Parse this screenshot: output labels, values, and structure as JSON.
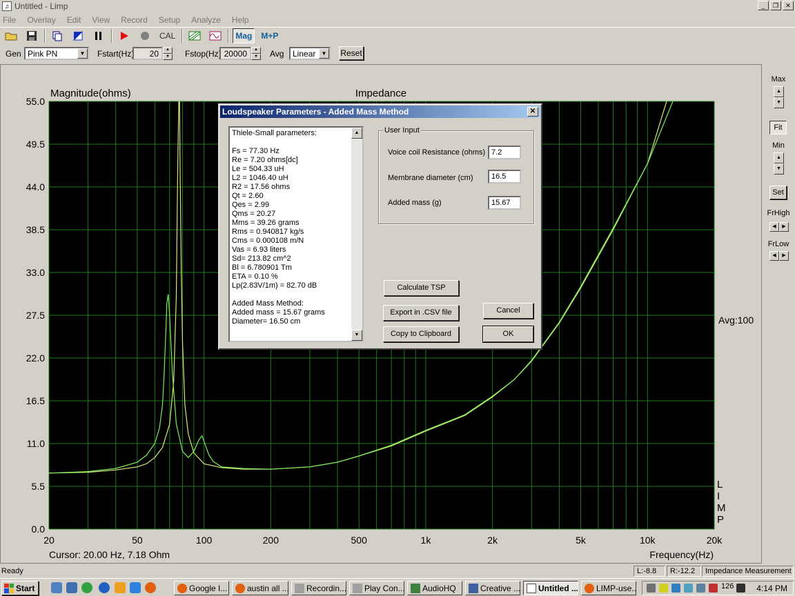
{
  "window": {
    "title": "Untitled - Limp",
    "min_glyph": "_",
    "max_glyph": "❐",
    "close_glyph": "✕"
  },
  "menu": [
    "File",
    "Overlay",
    "Edit",
    "View",
    "Record",
    "Setup",
    "Analyze",
    "Help"
  ],
  "toolbar": {
    "cal_label": "CAL",
    "mag_label": "Mag",
    "mp_label": "M+P"
  },
  "genbar": {
    "gen_label": "Gen",
    "gen_value": "Pink PN",
    "fstart_label": "Fstart(Hz)",
    "fstart_value": "20",
    "fstop_label": "Fstop(Hz)",
    "fstop_value": "20000",
    "avg_label": "Avg",
    "avg_value": "Linear",
    "reset_label": "Reset"
  },
  "chart_data": {
    "type": "line",
    "title": "Impedance",
    "ylabel": "Magnitude(ohms)",
    "xlabel": "Frequency(Hz)",
    "x_scale": "log",
    "xlim": [
      20,
      20000
    ],
    "ylim": [
      0,
      55
    ],
    "y_ticks": [
      "0.0",
      "5.5",
      "11.0",
      "16.5",
      "22.0",
      "27.5",
      "33.0",
      "38.5",
      "44.0",
      "49.5",
      "55.0"
    ],
    "x_ticks": [
      {
        "value": 20,
        "label": "20"
      },
      {
        "value": 50,
        "label": "50"
      },
      {
        "value": 100,
        "label": "100"
      },
      {
        "value": 200,
        "label": "200"
      },
      {
        "value": 500,
        "label": "500"
      },
      {
        "value": 1000,
        "label": "1k"
      },
      {
        "value": 2000,
        "label": "2k"
      },
      {
        "value": 5000,
        "label": "5k"
      },
      {
        "value": 10000,
        "label": "10k"
      },
      {
        "value": 20000,
        "label": "20k"
      }
    ],
    "grid": true,
    "background": "#000000",
    "grid_color": "#1f7a1f",
    "cursor_text": "Cursor: 20.00 Hz, 7.18 Ohm",
    "avg_text": "Avg:100",
    "side_text": [
      "L",
      "I",
      "M",
      "P"
    ],
    "series": [
      {
        "color": "#d8e878",
        "x": [
          20,
          30,
          40,
          50,
          55,
          60,
          65,
          70,
          73,
          75,
          76,
          77,
          77.3,
          77.6,
          78,
          79,
          80,
          82,
          85,
          90,
          100,
          120,
          150,
          200,
          300,
          400,
          500,
          700,
          1000,
          1500,
          2000,
          2500,
          3000,
          4000,
          5000,
          7000,
          10000,
          12500
        ],
        "y": [
          7.2,
          7.3,
          7.6,
          8.0,
          8.4,
          9.2,
          10.5,
          13.5,
          19.0,
          30.0,
          45.0,
          55.0,
          56.0,
          55.0,
          47.0,
          33.0,
          24.0,
          16.0,
          12.2,
          9.8,
          8.4,
          7.9,
          7.7,
          7.7,
          8.0,
          8.6,
          9.4,
          10.7,
          12.6,
          14.6,
          17.0,
          19.2,
          21.6,
          26.5,
          31.0,
          38.5,
          47.0,
          56.0
        ]
      },
      {
        "color": "#7aee5a",
        "x": [
          20,
          30,
          40,
          50,
          55,
          60,
          63,
          65,
          66,
          67,
          68,
          69,
          70,
          72,
          75,
          80,
          85,
          90,
          95,
          98,
          100,
          105,
          110,
          120,
          150,
          200,
          300,
          400,
          500,
          700,
          1000,
          1500,
          2000,
          2500,
          3000,
          4000,
          5000,
          7000,
          10000,
          13000
        ],
        "y": [
          7.2,
          7.4,
          7.8,
          8.6,
          9.5,
          11.0,
          13.0,
          16.0,
          19.5,
          24.0,
          29.0,
          30.2,
          27.5,
          20.0,
          13.5,
          10.0,
          9.2,
          10.0,
          11.5,
          12.0,
          11.3,
          9.6,
          8.7,
          8.0,
          7.8,
          7.7,
          8.0,
          8.6,
          9.4,
          10.8,
          12.7,
          14.7,
          17.1,
          19.2,
          21.7,
          26.6,
          31.2,
          38.7,
          47.0,
          55.0
        ]
      }
    ]
  },
  "rightpanel": {
    "max_label": "Max",
    "fit_label": "Fit",
    "min_label": "Min",
    "set_label": "Set",
    "frhigh_label": "FrHigh",
    "frlow_label": "FrLow"
  },
  "dialog": {
    "title": "Loudspeaker Parameters - Added Mass Method",
    "tsp_lines": [
      "Thiele-Small parameters:",
      "",
      "Fs  = 77.30 Hz",
      "Re  = 7.20 ohms[dc]",
      "Le  = 504.33 uH",
      "L2  = 1046.40 uH",
      "R2  = 17.56 ohms",
      "Qt  = 2.60",
      "Qes = 2.99",
      "Qms = 20.27",
      "Mms = 39.26 grams",
      "Rms = 0.940817 kg/s",
      "Cms = 0.000108 m/N",
      "Vas = 6.93 liters",
      "Sd= 213.82 cm^2",
      "Bl  = 6.780901 Tm",
      "ETA = 0.10 %",
      "Lp(2.83V/1m) = 82.70 dB",
      "",
      "Added Mass Method:",
      "Added mass = 15.67 grams",
      "Diameter= 16.50 cm"
    ],
    "group_label": "User Input",
    "vc_label": "Voice coil Resistance (ohms)",
    "vc_value": "7.2",
    "md_label": "Membrane diameter (cm)",
    "md_value": "16.5",
    "am_label": "Added mass (g)",
    "am_value": "15.67",
    "calc_label": "Calculate TSP",
    "export_label": "Export in .CSV file",
    "copy_label": "Copy to Clipboard",
    "cancel_label": "Cancel",
    "ok_label": "OK"
  },
  "status": {
    "ready": "Ready",
    "left": "L:-8.8",
    "right": "R:-12.2",
    "mode": "Impedance Measurement"
  },
  "taskbar": {
    "start_label": "Start",
    "tasks": [
      "Google I...",
      "austin all ...",
      "Recordin...",
      "Play Con...",
      "AudioHQ",
      "Creative ...",
      "Untitled ...",
      "LIMP-use..."
    ],
    "tray_number": "126",
    "clock": "4:14 PM"
  }
}
